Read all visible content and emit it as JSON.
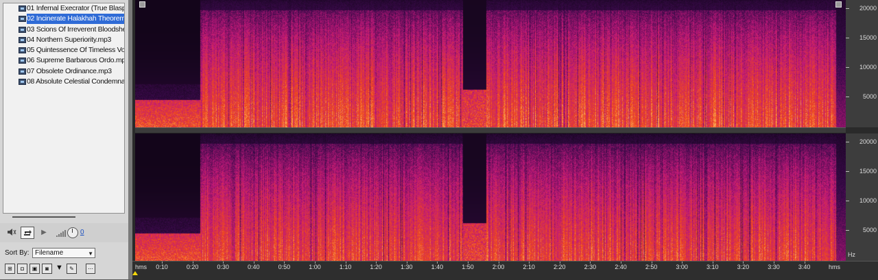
{
  "files": [
    {
      "label": "01 Infernal Execrator (True Blasp"
    },
    {
      "label": "02 Incinerate Halakhah Theorem"
    },
    {
      "label": "03 Scions Of Irreverent Bloodshe"
    },
    {
      "label": "04 Northern Superiority.mp3"
    },
    {
      "label": "05 Quintessence Of Timeless Voi"
    },
    {
      "label": "06 Supreme Barbarous Ordo.mp3"
    },
    {
      "label": "07 Obsolete Ordinance.mp3"
    },
    {
      "label": "08 Absolute Celestial Condemnat"
    }
  ],
  "selected_index": 1,
  "transport": {
    "volume_value": "0",
    "play_icon": "play-icon",
    "loop_icon": "loop-icon",
    "speaker_icon": "speaker-icon"
  },
  "sort": {
    "label": "Sort By:",
    "value": "Filename"
  },
  "spectral": {
    "freq_ticks": [
      "20000",
      "15000",
      "10000",
      "5000"
    ],
    "freq_unit": "Hz",
    "time_ticks": [
      "0:10",
      "0:20",
      "0:30",
      "0:40",
      "0:50",
      "1:00",
      "1:10",
      "1:20",
      "1:30",
      "1:40",
      "1:50",
      "2:00",
      "2:10",
      "2:20",
      "2:30",
      "2:40",
      "2:50",
      "3:00",
      "3:10",
      "3:20",
      "3:30",
      "3:40"
    ],
    "time_unit_left": "hms",
    "time_unit_right": "hms",
    "colors": {
      "background": "#0b0410",
      "low": "#3a0a4a",
      "mid": "#c0187a",
      "high": "#f04a1a",
      "peak": "#ffd070"
    }
  }
}
